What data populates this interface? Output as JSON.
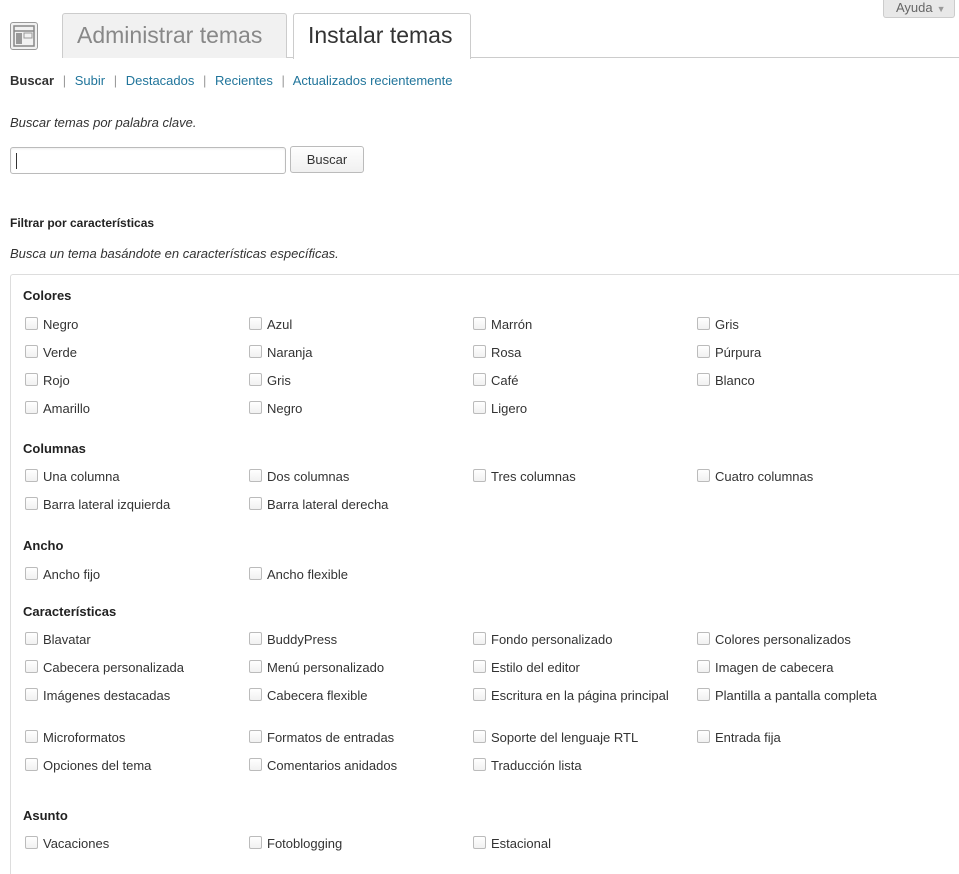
{
  "header": {
    "help_label": "Ayuda",
    "tabs": [
      {
        "label": "Administrar temas"
      },
      {
        "label": "Instalar temas"
      }
    ]
  },
  "subnav": {
    "current": "Buscar",
    "links": [
      "Subir",
      "Destacados",
      "Recientes",
      "Actualizados recientemente"
    ],
    "separator": "|"
  },
  "search": {
    "intro": "Buscar temas por palabra clave.",
    "value": "",
    "button_label": "Buscar"
  },
  "filter": {
    "title": "Filtrar por características",
    "description": "Busca un tema basándote en características específicas.",
    "groups": [
      {
        "title": "Colores",
        "options": [
          "Negro",
          "Azul",
          "Marrón",
          "Gris",
          "Verde",
          "Naranja",
          "Rosa",
          "Púrpura",
          "Rojo",
          "Gris",
          "Café",
          "Blanco",
          "Amarillo",
          "Negro",
          "Ligero"
        ]
      },
      {
        "title": "Columnas",
        "options": [
          "Una columna",
          "Dos columnas",
          "Tres columnas",
          "Cuatro columnas",
          "Barra lateral izquierda",
          "Barra lateral derecha"
        ]
      },
      {
        "title": "Ancho",
        "options": [
          "Ancho fijo",
          "Ancho flexible"
        ]
      },
      {
        "title": "Características",
        "options": [
          "Blavatar",
          "BuddyPress",
          "Fondo personalizado",
          "Colores personalizados",
          "Cabecera personalizada",
          "Menú personalizado",
          "Estilo del editor",
          "Imagen de cabecera",
          "Imágenes destacadas",
          "Cabecera flexible",
          "Escritura en la página principal",
          "Plantilla a pantalla completa",
          "Microformatos",
          "Formatos de entradas",
          "Soporte del lenguaje RTL",
          "Entrada fija",
          "Opciones del tema",
          "Comentarios anidados",
          "Traducción lista"
        ]
      },
      {
        "title": "Asunto",
        "options": [
          "Vacaciones",
          "Fotoblogging",
          "Estacional"
        ]
      }
    ]
  }
}
